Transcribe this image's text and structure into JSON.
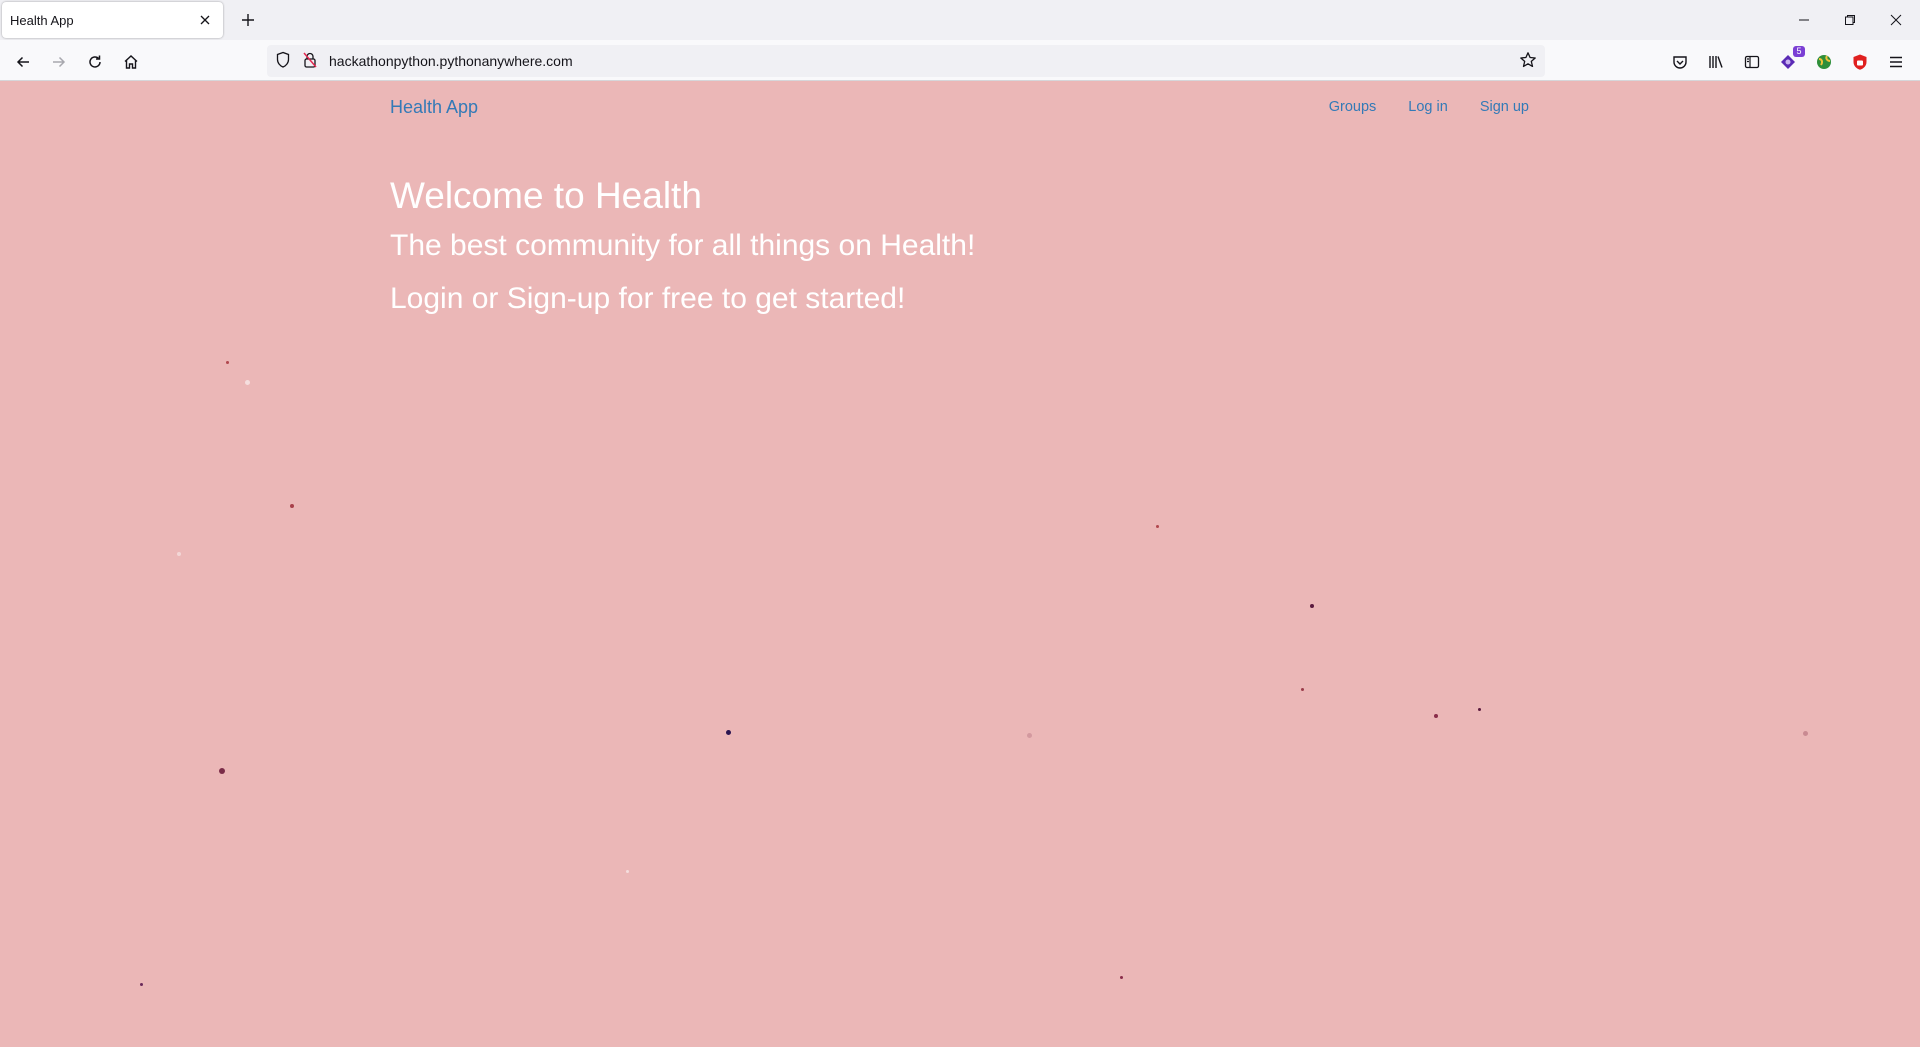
{
  "browser": {
    "tab_title": "Health App",
    "url": "hackathonpython.pythonanywhere.com",
    "extension_badge": "5"
  },
  "site": {
    "brand": "Health App",
    "nav": [
      {
        "label": "Groups"
      },
      {
        "label": "Log in"
      },
      {
        "label": "Sign up"
      }
    ],
    "welcome": "Welcome to Health",
    "tagline": "The best community for all things on Health!",
    "cta": "Login or Sign-up for free to get started!"
  },
  "colors": {
    "background": "#ebb7b7",
    "link": "#337ab7",
    "hero_text": "#ffffff"
  }
}
